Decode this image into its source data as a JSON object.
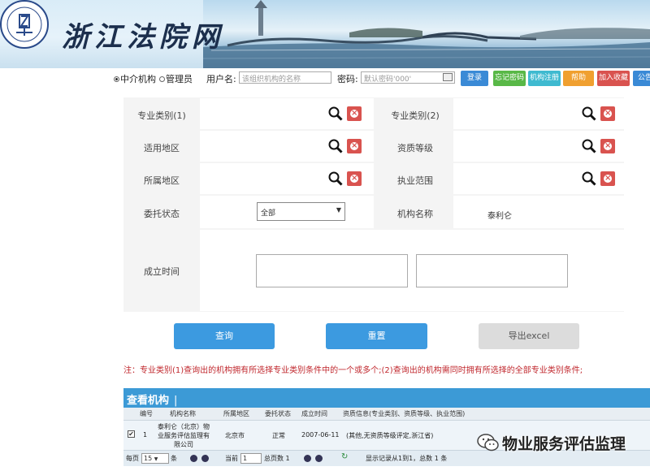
{
  "header": {
    "site_title": "浙江法院网"
  },
  "login": {
    "role_options": [
      {
        "label": "中介机构",
        "checked": true
      },
      {
        "label": "管理员",
        "checked": false
      }
    ],
    "username_label": "用户名:",
    "username_placeholder": "该组织机构的名称",
    "password_label": "密码:",
    "password_placeholder": "默认密码'000'",
    "buttons": [
      {
        "label": "登录",
        "color": "#3a8ad6"
      },
      {
        "label": "忘记密码",
        "color": "#59b847"
      },
      {
        "label": "机构注册",
        "color": "#3fbad0"
      },
      {
        "label": "帮助",
        "color": "#f0a030"
      },
      {
        "label": "加入收藏",
        "color": "#d9534f"
      },
      {
        "label": "公告",
        "color": "#3a8ad6"
      }
    ]
  },
  "form": {
    "field1_label": "专业类别(1)",
    "field2_label": "专业类别(2)",
    "area_label": "适用地区",
    "level_label": "资质等级",
    "region_label": "所属地区",
    "scope_label": "执业范围",
    "status_label": "委托状态",
    "status_value": "全部",
    "org_name_label": "机构名称",
    "org_name_value": "泰利仑",
    "established_label": "成立时间"
  },
  "actions": {
    "search": "查询",
    "reset": "重置",
    "export": "导出excel"
  },
  "note": "注：专业类别(1)查询出的机构拥有所选择专业类别条件中的一个或多个;(2)查询出的机构需同时拥有所选择的全部专业类别条件;",
  "results": {
    "title": "查看机构",
    "title_bar": "|",
    "columns": [
      "编号",
      "机构名称",
      "所属地区",
      "委托状态",
      "成立时间",
      "资质信息(专业类别、资质等级、执业范围)"
    ],
    "rows": [
      {
        "checked": true,
        "no": "1",
        "name_line1": "泰利仑（北京）物",
        "name_line2": "业服务评估监理有",
        "name_line3": "限公司",
        "region": "北京市",
        "status": "正常",
        "date": "2007-06-11",
        "qualification": "(其他,无资质等级评定,浙江省)"
      }
    ]
  },
  "pager": {
    "per_page_label": "每页",
    "per_page_value": "15",
    "per_page_suffix": "条",
    "current_label": "当前",
    "current_value": "1",
    "total_pages": "总页数 1",
    "summary": "显示记录从1到1，总数 1 条"
  },
  "watermark": {
    "text": "物业服务评估监理"
  }
}
